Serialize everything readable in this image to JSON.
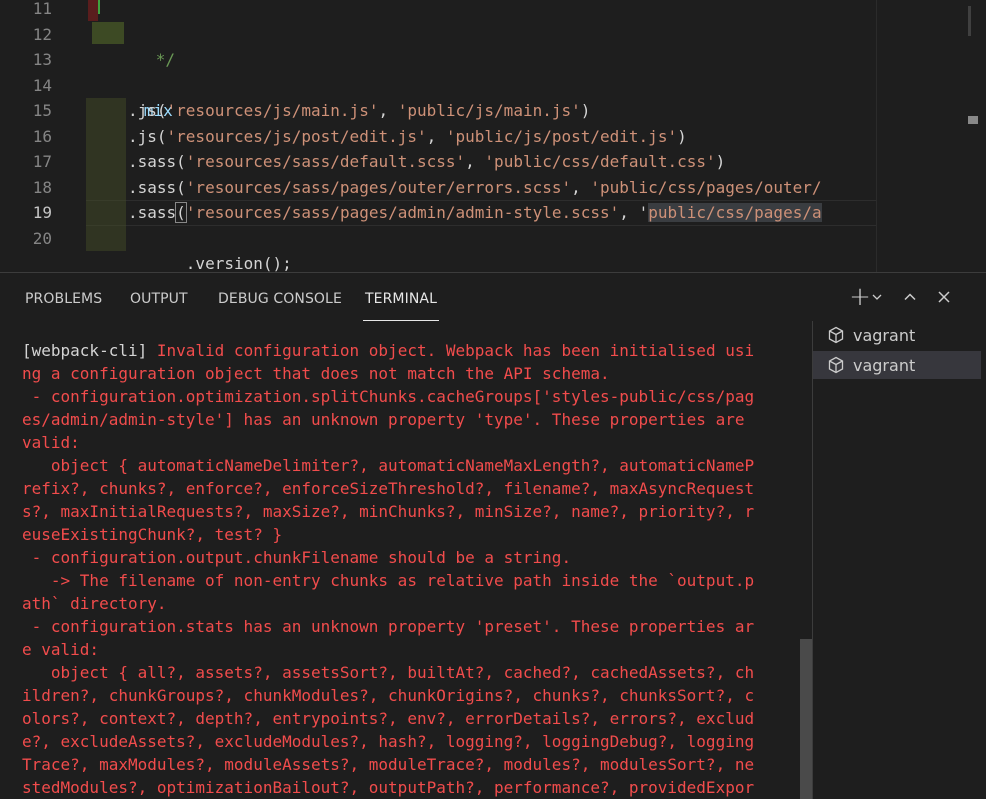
{
  "editor": {
    "line_numbers": [
      "11",
      "12",
      "13",
      "14",
      "15",
      "16",
      "17",
      "18",
      "19",
      "20"
    ],
    "lines": [
      {
        "num": "11",
        "code": ""
      },
      {
        "num": "12",
        "code": "*/"
      },
      {
        "num": "13",
        "code": ""
      },
      {
        "num": "14",
        "code": "mix"
      },
      {
        "num": "15",
        "parts": [
          ".js(",
          "'resources/js/main.js'",
          ", ",
          "'public/js/main.js'",
          ")"
        ]
      },
      {
        "num": "16",
        "parts": [
          ".js(",
          "'resources/js/post/edit.js'",
          ", ",
          "'public/js/post/edit.js'",
          ")"
        ]
      },
      {
        "num": "17",
        "parts": [
          ".sass(",
          "'resources/sass/default.scss'",
          ", ",
          "'public/css/default.css'",
          ")"
        ]
      },
      {
        "num": "18",
        "parts": [
          ".sass(",
          "'resources/sass/pages/outer/errors.scss'",
          ", ",
          "'public/css/pages/outer/",
          ""
        ]
      },
      {
        "num": "19",
        "parts": [
          ".sass",
          "(",
          "'resources/sass/pages/admin/admin-style.scss'",
          ", '",
          "public/css/pages/a"
        ]
      },
      {
        "num": "20",
        "code": ".version();"
      }
    ],
    "comment_end": "*/",
    "mix": "mix",
    "version_call": ".version();"
  },
  "panel": {
    "tabs": [
      {
        "label": "PROBLEMS"
      },
      {
        "label": "OUTPUT"
      },
      {
        "label": "DEBUG CONSOLE"
      },
      {
        "label": "TERMINAL",
        "active": true
      }
    ],
    "actions": {
      "new_terminal": "+",
      "dropdown": "⌄",
      "maximize": "^",
      "close": "✕"
    }
  },
  "terminal": {
    "prefix": "[webpack-cli]",
    "lines": [
      " Invalid configuration object. Webpack has been initialised usi",
      "ng a configuration object that does not match the API schema.",
      " - configuration.optimization.splitChunks.cacheGroups['styles-public/css/pag",
      "es/admin/admin-style'] has an unknown property 'type'. These properties are",
      "valid:",
      "   object { automaticNameDelimiter?, automaticNameMaxLength?, automaticNameP",
      "refix?, chunks?, enforce?, enforceSizeThreshold?, filename?, maxAsyncRequest",
      "s?, maxInitialRequests?, maxSize?, minChunks?, minSize?, name?, priority?, r",
      "euseExistingChunk?, test? }",
      " - configuration.output.chunkFilename should be a string.",
      "   -> The filename of non-entry chunks as relative path inside the `output.p",
      "ath` directory.",
      " - configuration.stats has an unknown property 'preset'. These properties ar",
      "e valid:",
      "   object { all?, assets?, assetsSort?, builtAt?, cached?, cachedAssets?, ch",
      "ildren?, chunkGroups?, chunkModules?, chunkOrigins?, chunks?, chunksSort?, c",
      "olors?, context?, depth?, entrypoints?, env?, errorDetails?, errors?, exclud",
      "e?, excludeAssets?, excludeModules?, hash?, logging?, loggingDebug?, logging",
      "Trace?, maxModules?, moduleAssets?, moduleTrace?, modules?, modulesSort?, ne",
      "stedModules?, optimizationBailout?, outputPath?, performance?, providedExpor"
    ],
    "instances": [
      {
        "name": "vagrant",
        "selected": false
      },
      {
        "name": "vagrant",
        "selected": true
      }
    ],
    "instance_icon": "terminal-vagrant-icon",
    "colors": {
      "error": "#f14c4c",
      "normal": "#d4d4d4"
    }
  }
}
